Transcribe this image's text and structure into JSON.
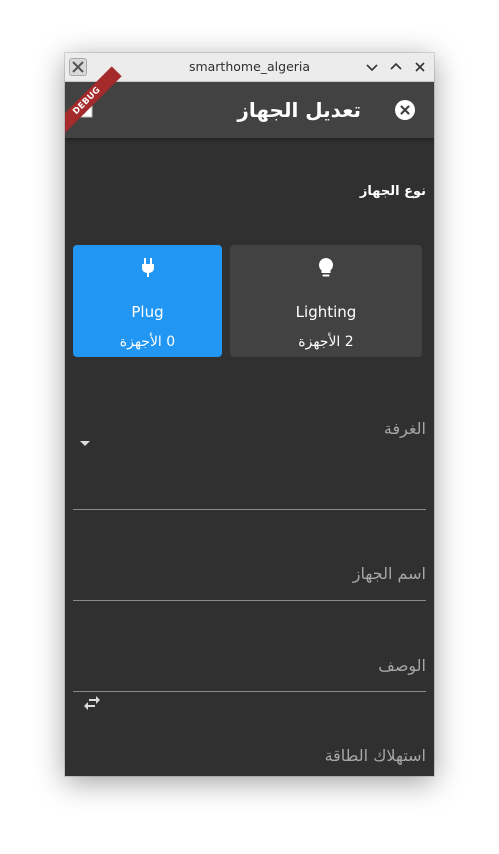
{
  "window": {
    "title": "smarthome_algeria",
    "buttons": [
      "minimize",
      "maximize",
      "close"
    ]
  },
  "appbar": {
    "title": "تعديل الجهاز",
    "debug_banner": "DEBUG"
  },
  "form": {
    "device_type_label": "نوع الجهاز",
    "device_types": [
      {
        "name": "Plug",
        "count_label": "0 الأجهزة",
        "icon": "plug-icon",
        "selected": true
      },
      {
        "name": "Lighting",
        "count_label": "2 الأجهزة",
        "icon": "lightbulb-icon",
        "selected": false
      }
    ],
    "room_label": "الغرفة",
    "device_name_label": "اسم الجهاز",
    "description_label": "الوصف",
    "power_label": "استهلاك الطاقة"
  },
  "colors": {
    "background": "#303030",
    "appbar": "#424242",
    "accent": "#2196f3",
    "card": "#424242",
    "debug": "#a42a2c"
  }
}
